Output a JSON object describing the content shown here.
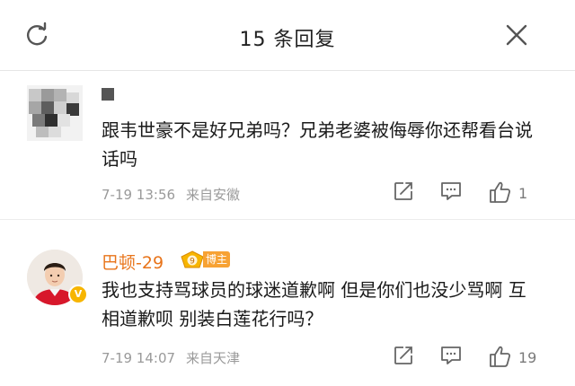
{
  "header": {
    "title": "15 条回复",
    "refresh_icon": "refresh-icon",
    "close_icon": "close-icon"
  },
  "comments": [
    {
      "name": "",
      "text": "跟韦世豪不是好兄弟吗？兄弟老婆被侮辱你还帮看台说话吗",
      "time": "7-19 13:56",
      "location": "来自安徽",
      "likes": "1",
      "avatar": "blurred-avatar"
    },
    {
      "name": "巴顿-29",
      "badge": "博主",
      "badge_level": "9",
      "text": "我也支持骂球员的球迷道歉啊 但是你们也没少骂啊 互相道歉呗 别装白莲花行吗？",
      "time": "7-19 14:07",
      "location": "来自天津",
      "likes": "19",
      "verified": "V"
    }
  ],
  "colors": {
    "username": "#e8741a",
    "badge": "#f7a234",
    "meta": "#9a9a9a"
  }
}
